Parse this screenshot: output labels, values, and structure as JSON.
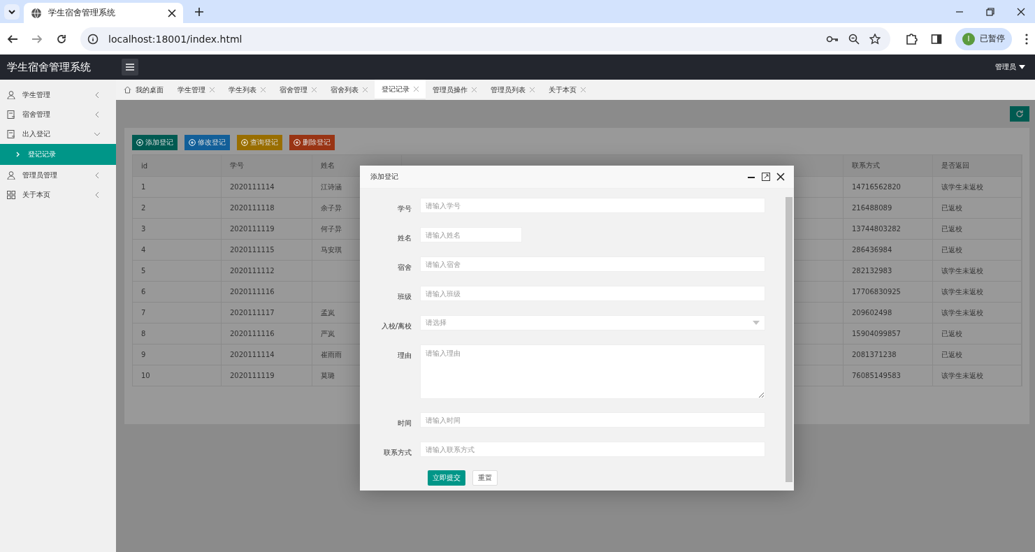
{
  "browser": {
    "tab_title": "学生宿舍管理系统",
    "url": "localhost:18001/index.html",
    "profile_initial": "I",
    "profile_label": "已暂停"
  },
  "app": {
    "title": "学生宿舍管理系统",
    "user": "管理员"
  },
  "sidebar": {
    "items": [
      {
        "label": "学生管理",
        "expanded": false
      },
      {
        "label": "宿舍管理",
        "expanded": false
      },
      {
        "label": "出入登记",
        "expanded": true,
        "children": [
          {
            "label": "登记记录",
            "selected": true
          }
        ]
      },
      {
        "label": "管理员管理",
        "expanded": false
      },
      {
        "label": "关于本页",
        "expanded": false
      }
    ]
  },
  "tabs": [
    {
      "label": "我的桌面",
      "kind": "home",
      "selected": false
    },
    {
      "label": "学生管理",
      "kind": "page",
      "selected": false
    },
    {
      "label": "学生列表",
      "kind": "page",
      "selected": false
    },
    {
      "label": "宿舍管理",
      "kind": "page",
      "selected": false
    },
    {
      "label": "宿舍列表",
      "kind": "page",
      "selected": false
    },
    {
      "label": "登记记录",
      "kind": "page",
      "selected": true
    },
    {
      "label": "管理员操作",
      "kind": "page",
      "selected": false
    },
    {
      "label": "管理员列表",
      "kind": "page",
      "selected": false
    },
    {
      "label": "关于本页",
      "kind": "page",
      "selected": false
    }
  ],
  "toolbar": [
    {
      "label": "添加登记",
      "color": "#005a52"
    },
    {
      "label": "修改登记",
      "color": "#125f99"
    },
    {
      "label": "查询登记",
      "color": "#996e00"
    },
    {
      "label": "删除登记",
      "color": "#993414"
    }
  ],
  "table": {
    "columns": {
      "id": "id",
      "student_no": "学号",
      "name": "姓名",
      "contact": "联系方式",
      "returned": "是否返回"
    },
    "rows": [
      {
        "id": "1",
        "student_no": "2020111114",
        "name": "江诗涵",
        "contact": "14716562820",
        "returned": "该学生未返校"
      },
      {
        "id": "2",
        "student_no": "2020111118",
        "name": "余子异",
        "contact": "216488089",
        "returned": "已返校"
      },
      {
        "id": "3",
        "student_no": "2020111119",
        "name": "何子异",
        "contact": "13744803282",
        "returned": "已返校"
      },
      {
        "id": "4",
        "student_no": "2020111115",
        "name": "马安琪",
        "contact": "286436984",
        "returned": "已返校"
      },
      {
        "id": "5",
        "student_no": "2020111112",
        "contact": "282132983",
        "returned": "该学生未返校"
      },
      {
        "id": "6",
        "student_no": "2020111116",
        "contact": "17706830925",
        "returned": "该学生未返校"
      },
      {
        "id": "7",
        "student_no": "2020111117",
        "name": "孟岚",
        "contact": "209602498",
        "returned": "该学生未返校"
      },
      {
        "id": "8",
        "student_no": "2020111116",
        "name": "严岚",
        "contact": "15904099857",
        "returned": "已返校"
      },
      {
        "id": "9",
        "student_no": "2020111114",
        "name": "崔雨雨",
        "contact": "2081371238",
        "returned": "已返校"
      },
      {
        "id": "10",
        "student_no": "2020111119",
        "name": "莫璐",
        "contact": "76085149583",
        "returned": "该学生未返校"
      }
    ]
  },
  "dialog": {
    "title": "添加登记",
    "fields": [
      {
        "label": "学号",
        "kind": "input",
        "placeholder": "请输入学号"
      },
      {
        "label": "姓名",
        "kind": "short",
        "placeholder": "请输入姓名"
      },
      {
        "label": "宿舍",
        "kind": "input",
        "placeholder": "请输入宿舍"
      },
      {
        "label": "班级",
        "kind": "input",
        "placeholder": "请输入班级"
      },
      {
        "label": "入校/离校",
        "kind": "select",
        "placeholder": "请选择"
      },
      {
        "label": "理由",
        "kind": "textarea",
        "placeholder": "请输入理由"
      },
      {
        "label": "时间",
        "kind": "input",
        "placeholder": "请输入时间"
      },
      {
        "label": "联系方式",
        "kind": "input",
        "placeholder": "请输入联系方式"
      }
    ],
    "buttons": [
      {
        "label": "立即提交",
        "kind": "primary"
      },
      {
        "label": "重置",
        "kind": "plain"
      }
    ]
  }
}
